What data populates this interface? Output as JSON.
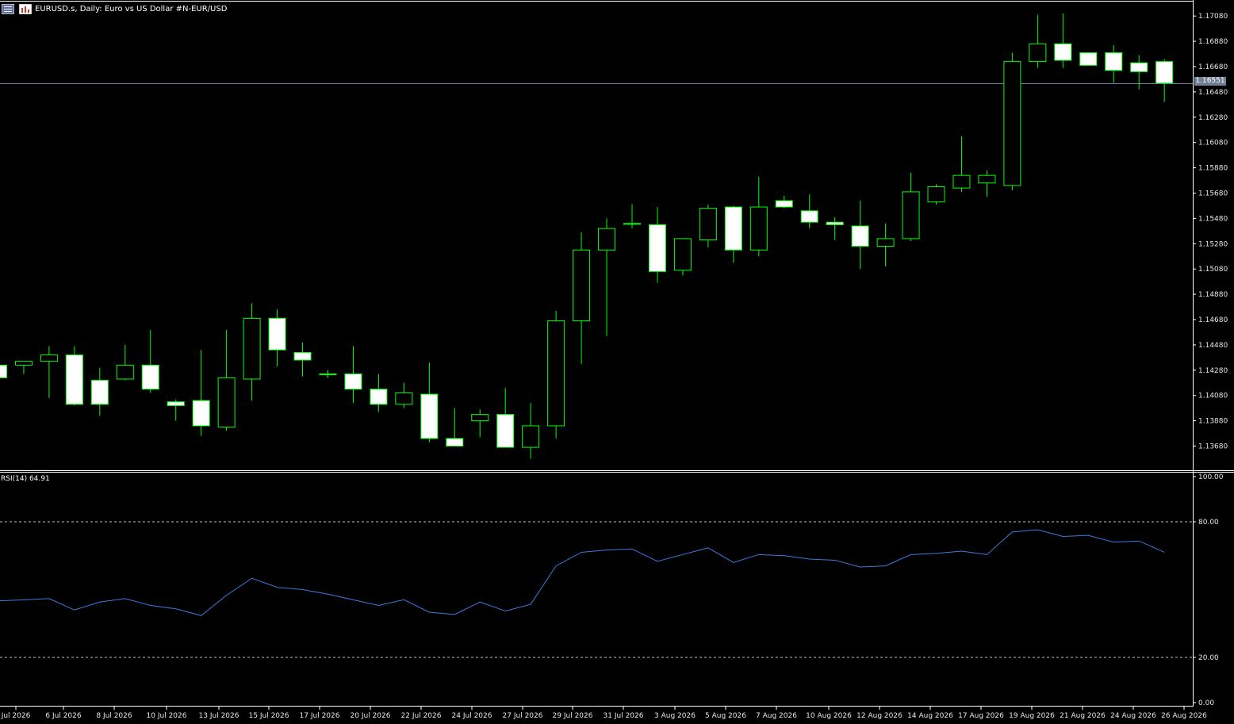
{
  "header": {
    "symbol_label": "EURUSD.s, Daily:  Euro vs US Dollar #N-EUR/USD"
  },
  "price_axis_labels": [
    "1.17080",
    "1.16880",
    "1.16680",
    "1.16480",
    "1.16280",
    "1.16080",
    "1.15880",
    "1.15680",
    "1.15480",
    "1.15280",
    "1.15080",
    "1.14880",
    "1.14680",
    "1.14480",
    "1.14280",
    "1.14080",
    "1.13880",
    "1.13680"
  ],
  "current_price": "1.16551",
  "rsi": {
    "label": "RSI(14) 64.91",
    "axis_labels": [
      "100.00",
      "80.00",
      "20.00",
      "0.00"
    ],
    "levels": [
      80,
      20
    ]
  },
  "date_labels": [
    "Jul 2026",
    "6 Jul 2026",
    "8 Jul 2026",
    "10 Jul 2026",
    "13 Jul 2026",
    "15 Jul 2026",
    "17 Jul 2026",
    "20 Jul 2026",
    "22 Jul 2026",
    "24 Jul 2026",
    "27 Jul 2026",
    "29 Jul 2026",
    "31 Jul 2026",
    "3 Aug 2026",
    "5 Aug 2026",
    "7 Aug 2026",
    "10 Aug 2026",
    "12 Aug 2026",
    "14 Aug 2026",
    "17 Aug 2026",
    "19 Aug 2026",
    "21 Aug 2026",
    "24 Aug 2026",
    "26 Aug 2026"
  ],
  "colors": {
    "background": "#000000",
    "candle_outline": "#00ff00",
    "bull_body": "#000000",
    "bear_body": "#ffffff",
    "rsi_line": "#3d7be0",
    "price_line": "#6f7f95",
    "axis_text": "#e6e6e6"
  },
  "chart_data": {
    "type": "candlestick",
    "title": "EURUSD.s, Daily:  Euro vs US Dollar #N-EUR/USD",
    "ylim": [
      1.1358,
      1.1717
    ],
    "candles": [
      {
        "o": 1.1432,
        "h": 1.1434,
        "l": 1.1422,
        "c": 1.1422
      },
      {
        "o": 1.1432,
        "h": 1.1435,
        "l": 1.1425,
        "c": 1.1435
      },
      {
        "o": 1.1435,
        "h": 1.1447,
        "l": 1.1406,
        "c": 1.144
      },
      {
        "o": 1.144,
        "h": 1.1447,
        "l": 1.14,
        "c": 1.1401
      },
      {
        "o": 1.142,
        "h": 1.143,
        "l": 1.1392,
        "c": 1.1401
      },
      {
        "o": 1.1421,
        "h": 1.1448,
        "l": 1.142,
        "c": 1.1432
      },
      {
        "o": 1.1432,
        "h": 1.146,
        "l": 1.141,
        "c": 1.1413
      },
      {
        "o": 1.1403,
        "h": 1.1405,
        "l": 1.1388,
        "c": 1.14
      },
      {
        "o": 1.1404,
        "h": 1.1444,
        "l": 1.1376,
        "c": 1.1384
      },
      {
        "o": 1.1383,
        "h": 1.146,
        "l": 1.138,
        "c": 1.1422
      },
      {
        "o": 1.1421,
        "h": 1.1481,
        "l": 1.1404,
        "c": 1.1469
      },
      {
        "o": 1.1469,
        "h": 1.1476,
        "l": 1.1431,
        "c": 1.1444
      },
      {
        "o": 1.1442,
        "h": 1.145,
        "l": 1.1423,
        "c": 1.1436
      },
      {
        "o": 1.1425,
        "h": 1.1428,
        "l": 1.1422,
        "c": 1.1425
      },
      {
        "o": 1.1425,
        "h": 1.1447,
        "l": 1.1402,
        "c": 1.1413
      },
      {
        "o": 1.1413,
        "h": 1.1425,
        "l": 1.1395,
        "c": 1.1401
      },
      {
        "o": 1.1401,
        "h": 1.1418,
        "l": 1.1398,
        "c": 1.141
      },
      {
        "o": 1.1409,
        "h": 1.1434,
        "l": 1.1371,
        "c": 1.1374
      },
      {
        "o": 1.1374,
        "h": 1.1398,
        "l": 1.1369,
        "c": 1.1368
      },
      {
        "o": 1.1388,
        "h": 1.1397,
        "l": 1.1375,
        "c": 1.1393
      },
      {
        "o": 1.1393,
        "h": 1.1414,
        "l": 1.1368,
        "c": 1.1367
      },
      {
        "o": 1.1367,
        "h": 1.1402,
        "l": 1.1358,
        "c": 1.1384
      },
      {
        "o": 1.1384,
        "h": 1.1475,
        "l": 1.1374,
        "c": 1.1467
      },
      {
        "o": 1.1467,
        "h": 1.1537,
        "l": 1.1433,
        "c": 1.1523
      },
      {
        "o": 1.1523,
        "h": 1.1548,
        "l": 1.1455,
        "c": 1.154
      },
      {
        "o": 1.1544,
        "h": 1.1559,
        "l": 1.154,
        "c": 1.1544
      },
      {
        "o": 1.1543,
        "h": 1.1557,
        "l": 1.1497,
        "c": 1.1506
      },
      {
        "o": 1.1507,
        "h": 1.1532,
        "l": 1.1503,
        "c": 1.1532
      },
      {
        "o": 1.1531,
        "h": 1.1559,
        "l": 1.1525,
        "c": 1.1556
      },
      {
        "o": 1.1557,
        "h": 1.1558,
        "l": 1.1513,
        "c": 1.1523
      },
      {
        "o": 1.1523,
        "h": 1.1581,
        "l": 1.1518,
        "c": 1.1557
      },
      {
        "o": 1.1562,
        "h": 1.1566,
        "l": 1.1556,
        "c": 1.1557
      },
      {
        "o": 1.1554,
        "h": 1.1567,
        "l": 1.154,
        "c": 1.1545
      },
      {
        "o": 1.1545,
        "h": 1.1549,
        "l": 1.1531,
        "c": 1.1543
      },
      {
        "o": 1.1542,
        "h": 1.1562,
        "l": 1.1508,
        "c": 1.1526
      },
      {
        "o": 1.1526,
        "h": 1.1544,
        "l": 1.151,
        "c": 1.1532
      },
      {
        "o": 1.1532,
        "h": 1.1584,
        "l": 1.153,
        "c": 1.1569
      },
      {
        "o": 1.1561,
        "h": 1.1575,
        "l": 1.1559,
        "c": 1.1573
      },
      {
        "o": 1.1572,
        "h": 1.1613,
        "l": 1.1569,
        "c": 1.1582
      },
      {
        "o": 1.1576,
        "h": 1.1586,
        "l": 1.1565,
        "c": 1.1582
      },
      {
        "o": 1.1574,
        "h": 1.1679,
        "l": 1.157,
        "c": 1.1672
      },
      {
        "o": 1.1672,
        "h": 1.1709,
        "l": 1.1667,
        "c": 1.1686
      },
      {
        "o": 1.1686,
        "h": 1.171,
        "l": 1.1667,
        "c": 1.1673
      },
      {
        "o": 1.1679,
        "h": 1.1679,
        "l": 1.1669,
        "c": 1.1669
      },
      {
        "o": 1.1679,
        "h": 1.1685,
        "l": 1.1655,
        "c": 1.1665
      },
      {
        "o": 1.1671,
        "h": 1.1677,
        "l": 1.165,
        "c": 1.1664
      },
      {
        "o": 1.1672,
        "h": 1.1674,
        "l": 1.164,
        "c": 1.1655
      }
    ],
    "rsi_values": [
      45,
      45.5,
      46,
      41,
      44.5,
      46,
      43,
      41.5,
      38.5,
      47.5,
      55,
      51,
      50,
      48,
      45.5,
      43,
      45.5,
      40,
      39,
      44.5,
      40.5,
      43.5,
      60.5,
      66.5,
      67.5,
      68,
      62.5,
      65.5,
      68.5,
      62,
      65.5,
      65,
      63.5,
      63,
      60,
      60.5,
      65.5,
      66,
      67,
      65.5,
      75.5,
      76.5,
      73.5,
      74,
      71,
      71.5,
      66.5
    ],
    "rsi_ylim": [
      0,
      100
    ]
  }
}
